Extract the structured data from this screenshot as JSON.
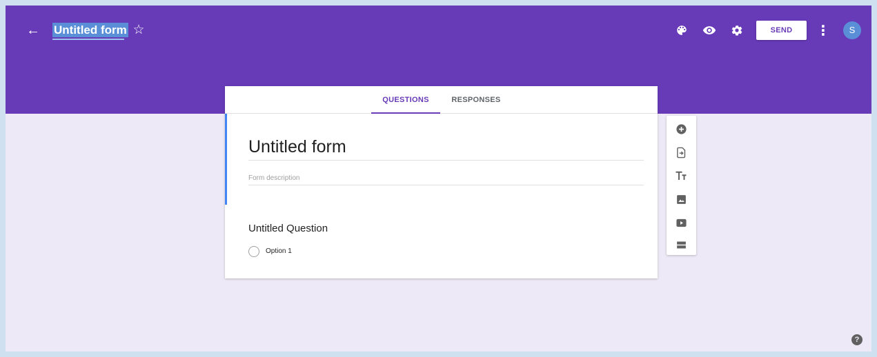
{
  "header": {
    "title": "Untitled form",
    "back_icon": "←",
    "star_icon": "☆",
    "send_label": "SEND",
    "more_icon": "⋮",
    "avatar_initial": "S",
    "bg_color": "#673ab7"
  },
  "tabs": [
    {
      "label": "QUESTIONS",
      "active": true
    },
    {
      "label": "RESPONSES",
      "active": false
    }
  ],
  "form": {
    "title": "Untitled form",
    "description_placeholder": "Form description",
    "accent_color": "#4285f4"
  },
  "question": {
    "title": "Untitled Question",
    "options": [
      "Option 1"
    ]
  },
  "toolbar": {
    "items": [
      "add-question-icon",
      "import-questions-icon",
      "add-title-icon",
      "add-image-icon",
      "add-video-icon",
      "add-section-icon"
    ]
  },
  "help_icon": "?",
  "colors": {
    "primary": "#673ab7",
    "page_bg": "#ede9f6",
    "accent": "#4285f4"
  }
}
